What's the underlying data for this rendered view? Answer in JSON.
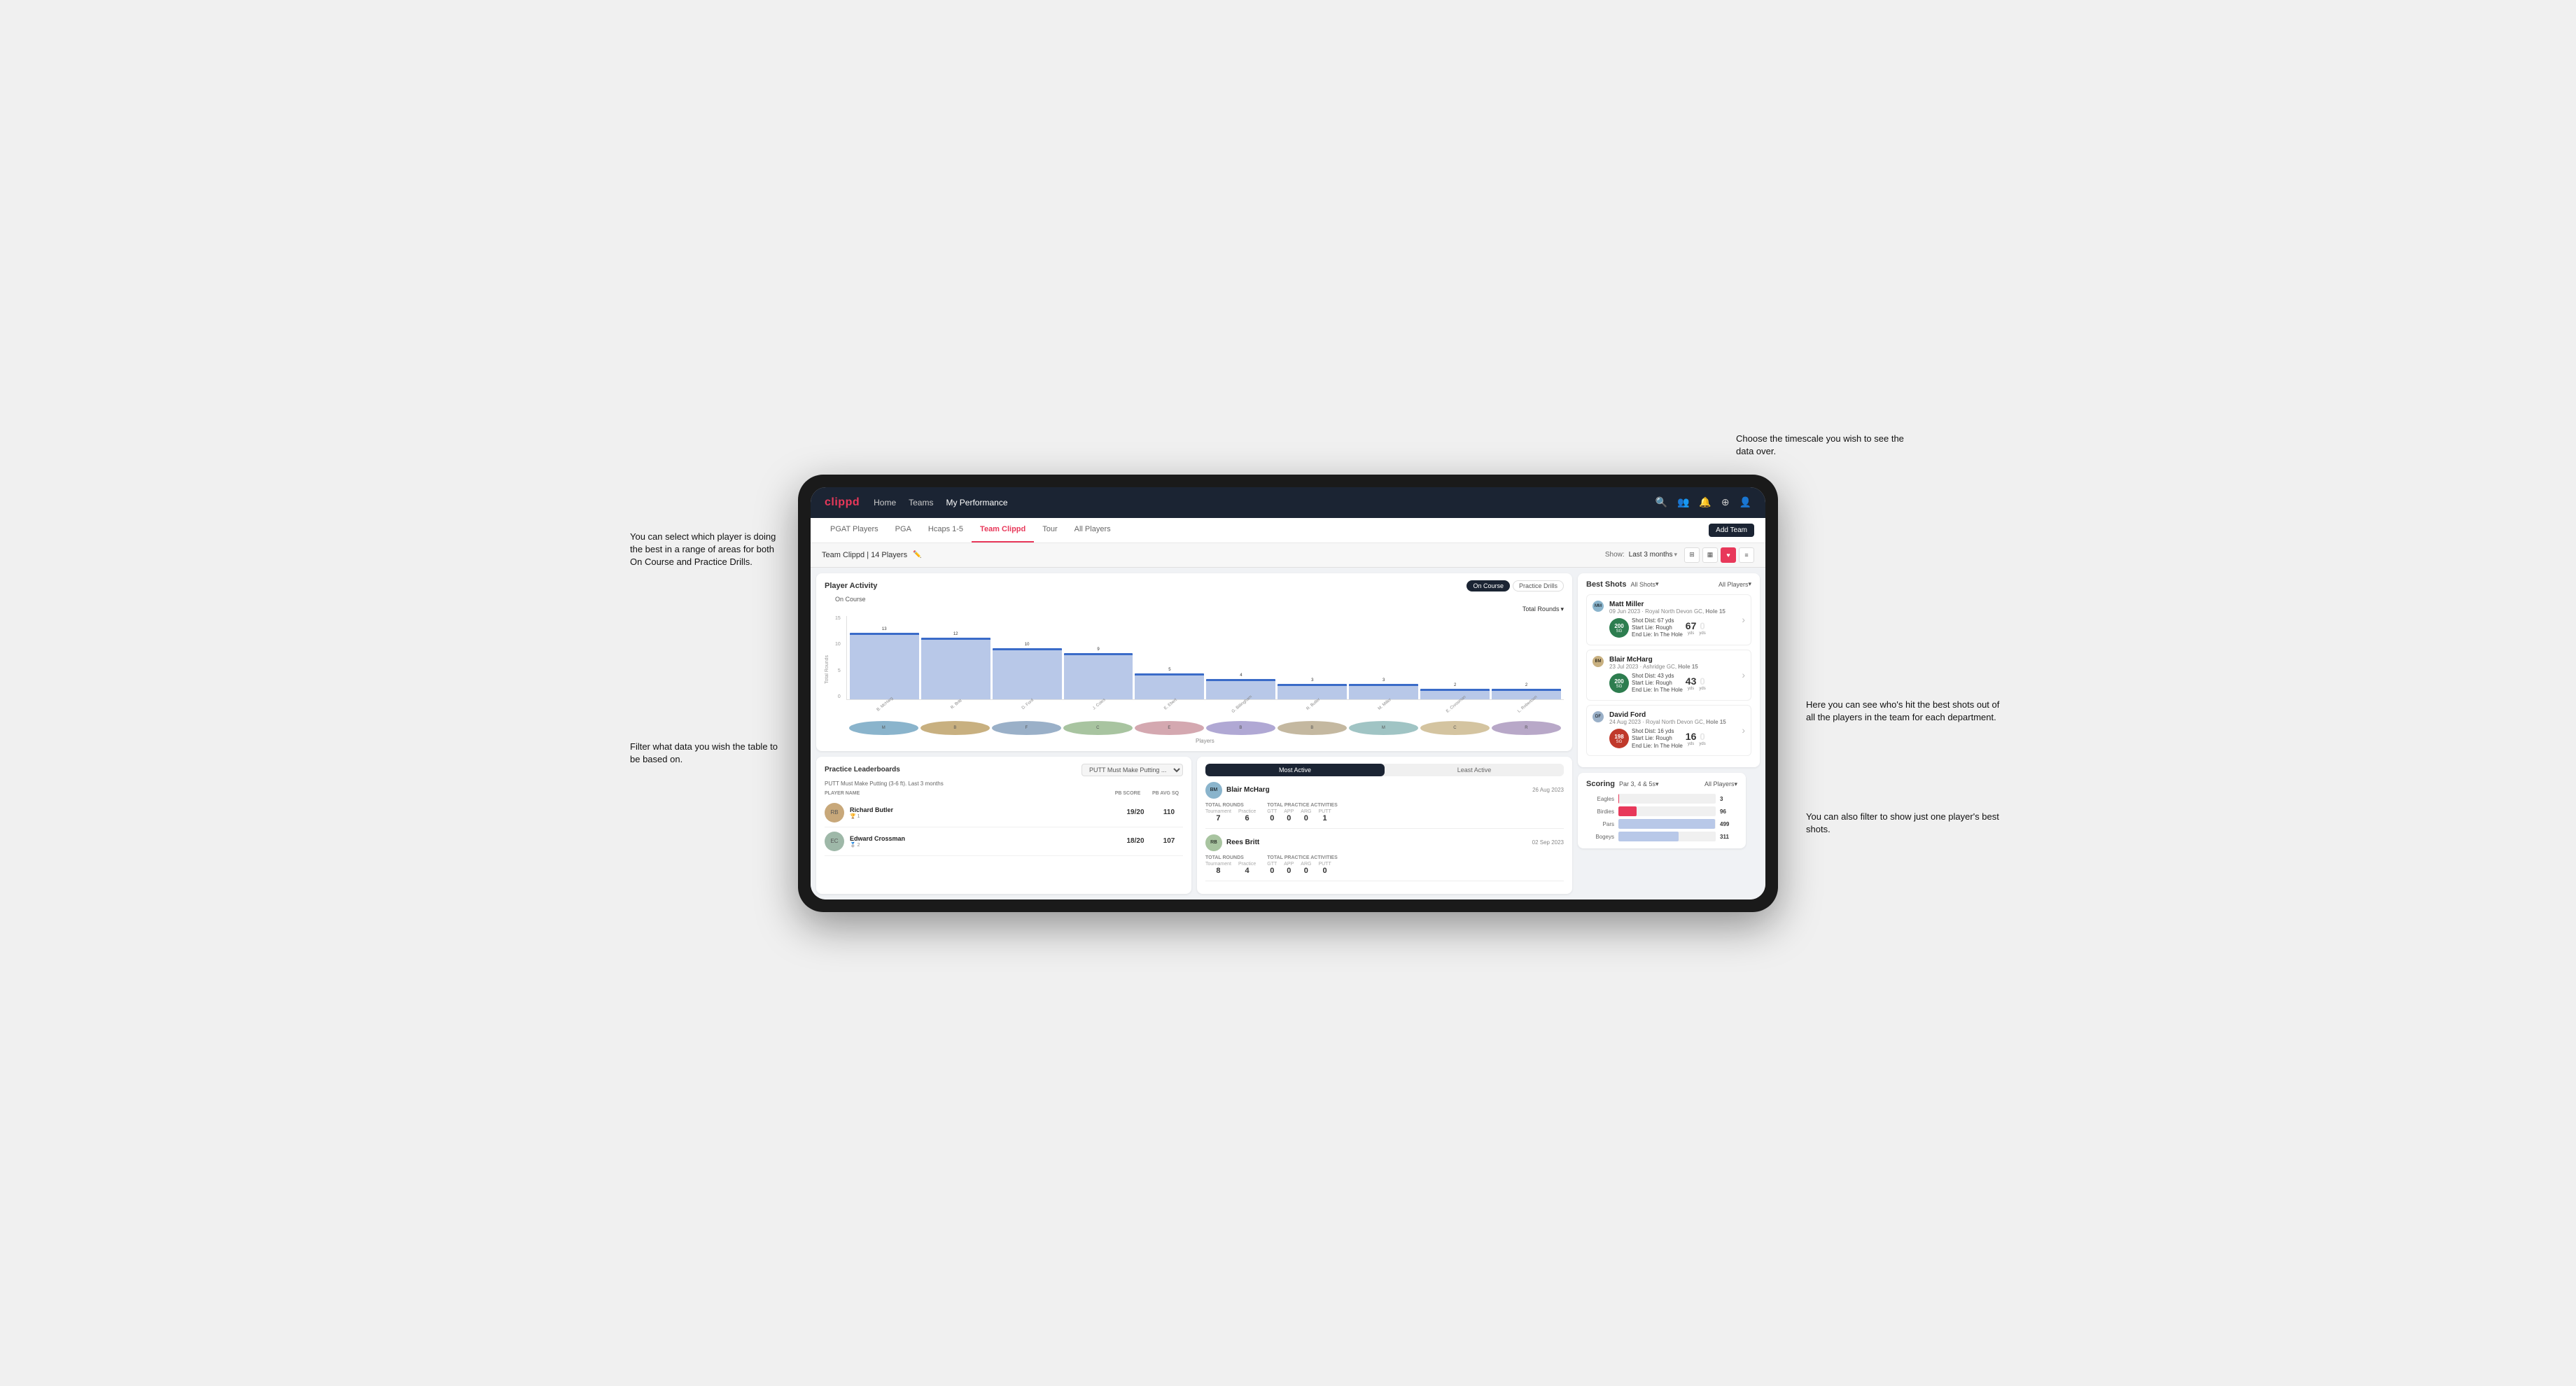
{
  "annotations": {
    "top_right": "Choose the timescale you wish to see the data over.",
    "left_top": "You can select which player is doing the best in a range of areas for both On Course and Practice Drills.",
    "left_bottom": "Filter what data you wish the table to be based on.",
    "right_middle": "Here you can see who's hit the best shots out of all the players in the team for each department.",
    "right_bottom": "You can also filter to show just one player's best shots."
  },
  "nav": {
    "logo": "clippd",
    "links": [
      "Home",
      "Teams",
      "My Performance"
    ],
    "icons": [
      "search",
      "people",
      "bell",
      "add-circle",
      "profile"
    ]
  },
  "sub_nav": {
    "tabs": [
      "PGAT Players",
      "PGA",
      "Hcaps 1-5",
      "Team Clippd",
      "Tour",
      "All Players"
    ],
    "active": "Team Clippd",
    "add_button": "Add Team"
  },
  "team_header": {
    "name": "Team Clippd | 14 Players",
    "show_label": "Show:",
    "show_value": "Last 3 months",
    "view_modes": [
      "grid-large",
      "grid",
      "heart",
      "list"
    ]
  },
  "player_activity": {
    "title": "Player Activity",
    "tabs": [
      "On Course",
      "Practice Drills"
    ],
    "active_tab": "On Course",
    "section_label": "On Course",
    "chart_dropdown": "Total Rounds",
    "y_axis_label": "Total Rounds",
    "y_labels": [
      "15",
      "10",
      "5",
      "0"
    ],
    "bars": [
      {
        "player": "B. McHarg",
        "value": 13,
        "height_pct": 87
      },
      {
        "player": "R. Britt",
        "value": 12,
        "height_pct": 80
      },
      {
        "player": "D. Ford",
        "value": 10,
        "height_pct": 67
      },
      {
        "player": "J. Coles",
        "value": 9,
        "height_pct": 60
      },
      {
        "player": "E. Ebert",
        "value": 5,
        "height_pct": 33
      },
      {
        "player": "G. Billingham",
        "value": 4,
        "height_pct": 27
      },
      {
        "player": "R. Butler",
        "value": 3,
        "height_pct": 20
      },
      {
        "player": "M. Miller",
        "value": 3,
        "height_pct": 20
      },
      {
        "player": "E. Crossman",
        "value": 2,
        "height_pct": 13
      },
      {
        "player": "L. Robertson",
        "value": 2,
        "height_pct": 13
      }
    ],
    "x_axis_title": "Players"
  },
  "best_shots": {
    "title": "Best Shots",
    "filter1": "All Shots",
    "filter2": "All Players",
    "players": [
      {
        "name": "Matt Miller",
        "date": "09 Jun 2023",
        "course": "Royal North Devon GC",
        "hole": "Hole 15",
        "badge": "200",
        "badge_label": "SG",
        "badge_color": "green",
        "shot_dist": "67 yds",
        "start_lie": "Rough",
        "end_lie": "In The Hole",
        "dist1": "67",
        "dist1_label": "yds",
        "dist2": "0",
        "dist2_label": "yds"
      },
      {
        "name": "Blair McHarg",
        "date": "23 Jul 2023",
        "course": "Ashridge GC",
        "hole": "Hole 15",
        "badge": "200",
        "badge_label": "SG",
        "badge_color": "green",
        "shot_dist": "43 yds",
        "start_lie": "Rough",
        "end_lie": "In The Hole",
        "dist1": "43",
        "dist1_label": "yds",
        "dist2": "0",
        "dist2_label": "yds"
      },
      {
        "name": "David Ford",
        "date": "24 Aug 2023",
        "course": "Royal North Devon GC",
        "hole": "Hole 15",
        "badge": "198",
        "badge_label": "SG",
        "badge_color": "red",
        "shot_dist": "16 yds",
        "start_lie": "Rough",
        "end_lie": "In The Hole",
        "dist1": "16",
        "dist1_label": "yds",
        "dist2": "0",
        "dist2_label": "yds"
      }
    ]
  },
  "practice_leaderboards": {
    "title": "Practice Leaderboards",
    "dropdown": "PUTT Must Make Putting ...",
    "subtitle": "PUTT Must Make Putting (3-6 ft). Last 3 months",
    "columns": [
      "PLAYER NAME",
      "PB SCORE",
      "PB AVG SQ"
    ],
    "players": [
      {
        "name": "Richard Butler",
        "rank": "1",
        "pb_score": "19/20",
        "pb_avg": "110"
      },
      {
        "name": "Edward Crossman",
        "rank": "2",
        "pb_score": "18/20",
        "pb_avg": "107"
      }
    ]
  },
  "most_active": {
    "tabs": [
      "Most Active",
      "Least Active"
    ],
    "active_tab": "Most Active",
    "players": [
      {
        "name": "Blair McHarg",
        "date": "26 Aug 2023",
        "total_rounds_label": "Total Rounds",
        "tournament": "7",
        "practice": "6",
        "practice_label": "Practice",
        "tournament_label": "Tournament",
        "total_practice_label": "Total Practice Activities",
        "gtt": "0",
        "app": "0",
        "arg": "0",
        "putt": "1"
      },
      {
        "name": "Rees Britt",
        "date": "02 Sep 2023",
        "total_rounds_label": "Total Rounds",
        "tournament": "8",
        "practice": "4",
        "practice_label": "Practice",
        "tournament_label": "Tournament",
        "total_practice_label": "Total Practice Activities",
        "gtt": "0",
        "app": "0",
        "arg": "0",
        "putt": "0"
      }
    ]
  },
  "scoring": {
    "title": "Scoring",
    "filter1": "Par 3, 4 & 5s",
    "filter2": "All Players",
    "rows": [
      {
        "label": "Eagles",
        "value": 3,
        "pct": 1,
        "color": "eagles"
      },
      {
        "label": "Birdies",
        "value": 96,
        "pct": 19,
        "color": "birdies"
      },
      {
        "label": "Pars",
        "value": 499,
        "pct": 99,
        "color": "pars"
      },
      {
        "label": "Bogeys",
        "value": 311,
        "pct": 62,
        "color": "pars"
      }
    ]
  }
}
